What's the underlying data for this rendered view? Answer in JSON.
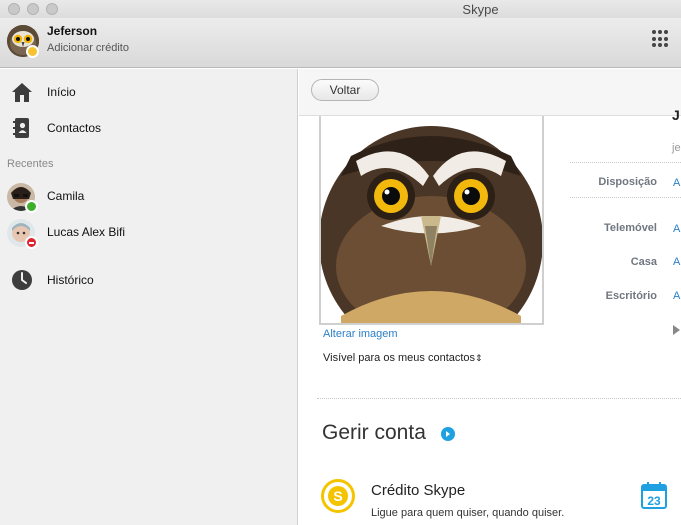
{
  "window": {
    "title": "Skype"
  },
  "header": {
    "user_name": "Jeferson",
    "credit_link": "Adicionar crédito",
    "dialpad_icon": "dialpad-icon"
  },
  "sidebar": {
    "items": [
      {
        "label": "Início",
        "icon": "home-icon"
      },
      {
        "label": "Contactos",
        "icon": "contacts-icon"
      }
    ],
    "recent_label": "Recentes",
    "recents": [
      {
        "name": "Camila",
        "status": "online",
        "status_color": "#3fae2a"
      },
      {
        "name": "Lucas Alex Bifi",
        "status": "do-not-disturb",
        "status_color": "#e0242f"
      }
    ],
    "history": {
      "label": "Histórico",
      "icon": "clock-icon"
    }
  },
  "toolbar": {
    "back_label": "Voltar"
  },
  "profile": {
    "change_image": "Alterar imagem",
    "visibility": "Visível para os meus contactos",
    "name_partial": "J",
    "email_partial": "je",
    "details": [
      {
        "label": "Disposição",
        "value": "A"
      },
      {
        "label": "Telemóvel",
        "value": "A"
      },
      {
        "label": "Casa",
        "value": "A"
      },
      {
        "label": "Escritório",
        "value": "A"
      }
    ]
  },
  "account": {
    "title": "Gerir conta",
    "credit_title": "Crédito Skype",
    "credit_subtitle": "Ligue para quem quiser, quando quiser.",
    "calendar_day": "23"
  },
  "colors": {
    "link": "#2a80c8",
    "accent": "#1ea0e1",
    "credit": "#f5c400"
  }
}
